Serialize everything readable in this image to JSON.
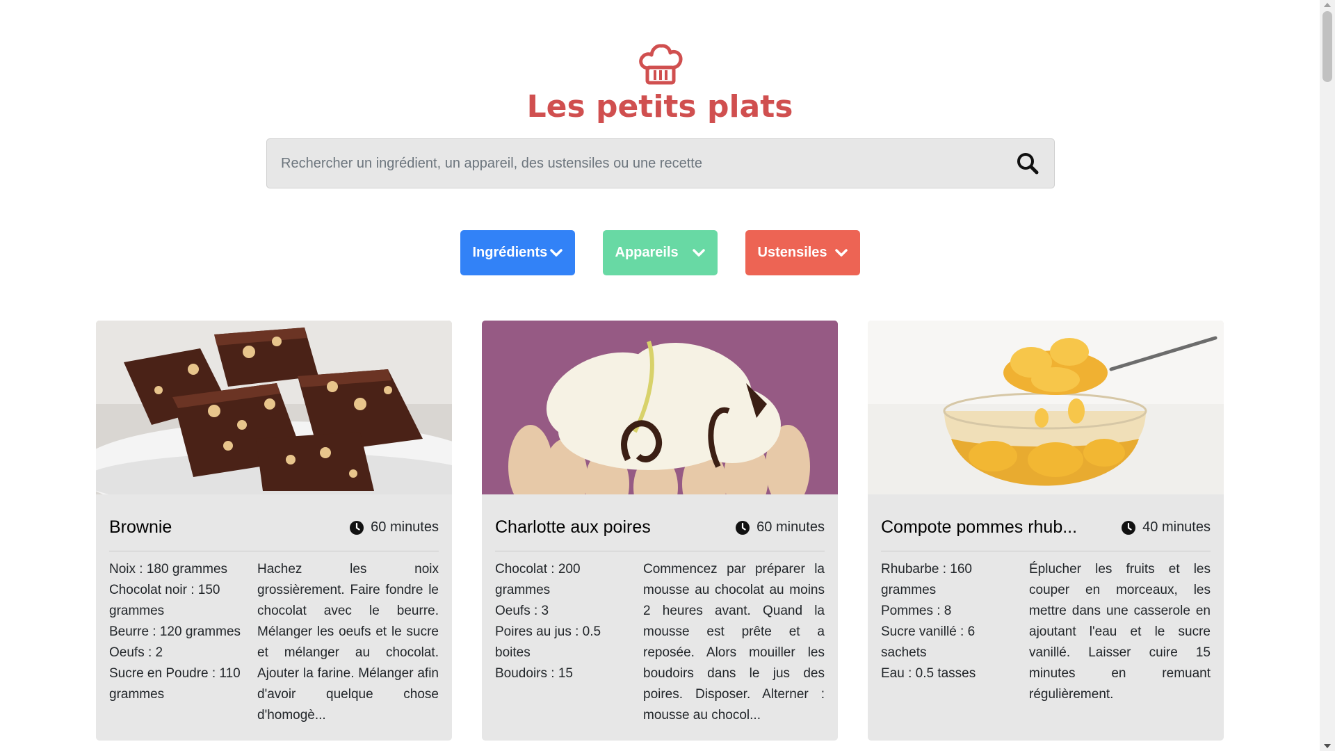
{
  "header": {
    "brand": "Les petits plats",
    "logo_icon": "chef-hat-icon",
    "brand_color": "#d04f4f"
  },
  "search": {
    "placeholder": "Rechercher un ingrédient, un appareil, des ustensiles ou une recette",
    "value": "",
    "icon": "search-icon"
  },
  "filters": {
    "ingredients_label": "Ingrédients",
    "appliances_label": "Appareils",
    "utensils_label": "Ustensiles",
    "colors": {
      "ingredients": "#3282f7",
      "appliances": "#68d9a4",
      "utensils": "#ed6454"
    }
  },
  "recipes": [
    {
      "title": "Brownie",
      "time": "60 minutes",
      "ingredients": [
        "Noix : 180 grammes",
        "Chocolat noir : 150 grammes",
        "Beurre : 120 grammes",
        "Oeufs : 2",
        "Sucre en Poudre : 110 grammes"
      ],
      "description": "Hachez les noix grossièrement. Faire fondre le chocolat avec le beurre. Mélanger les oeufs et le sucre et mélanger au chocolat. Ajouter la farine. Mélanger afin d'avoir quelque chose d'homogè..."
    },
    {
      "title": "Charlotte aux poires",
      "time": "60 minutes",
      "ingredients": [
        "Chocolat : 200 grammes",
        "Oeufs : 3",
        "Poires au jus : 0.5 boites",
        "Boudoirs : 15"
      ],
      "description": "Commencez par préparer la mousse au chocolat au moins 2 heures avant. Quand la mousse est prête et a reposée. Alors mouiller les boudoirs dans le jus des poires. Disposer. Alterner : mousse au chocol..."
    },
    {
      "title": "Compote pommes rhub...",
      "time": "40 minutes",
      "ingredients": [
        "Rhubarbe : 160 grammes",
        "Pommes : 8",
        "Sucre vanillé : 6 sachets",
        "Eau : 0.5 tasses"
      ],
      "description": "Éplucher les fruits et les couper en morceaux, les mettre dans une casserole en ajoutant l'eau et le sucre vanillé. Laisser cuire 15 minutes en remuant régulièrement."
    }
  ]
}
